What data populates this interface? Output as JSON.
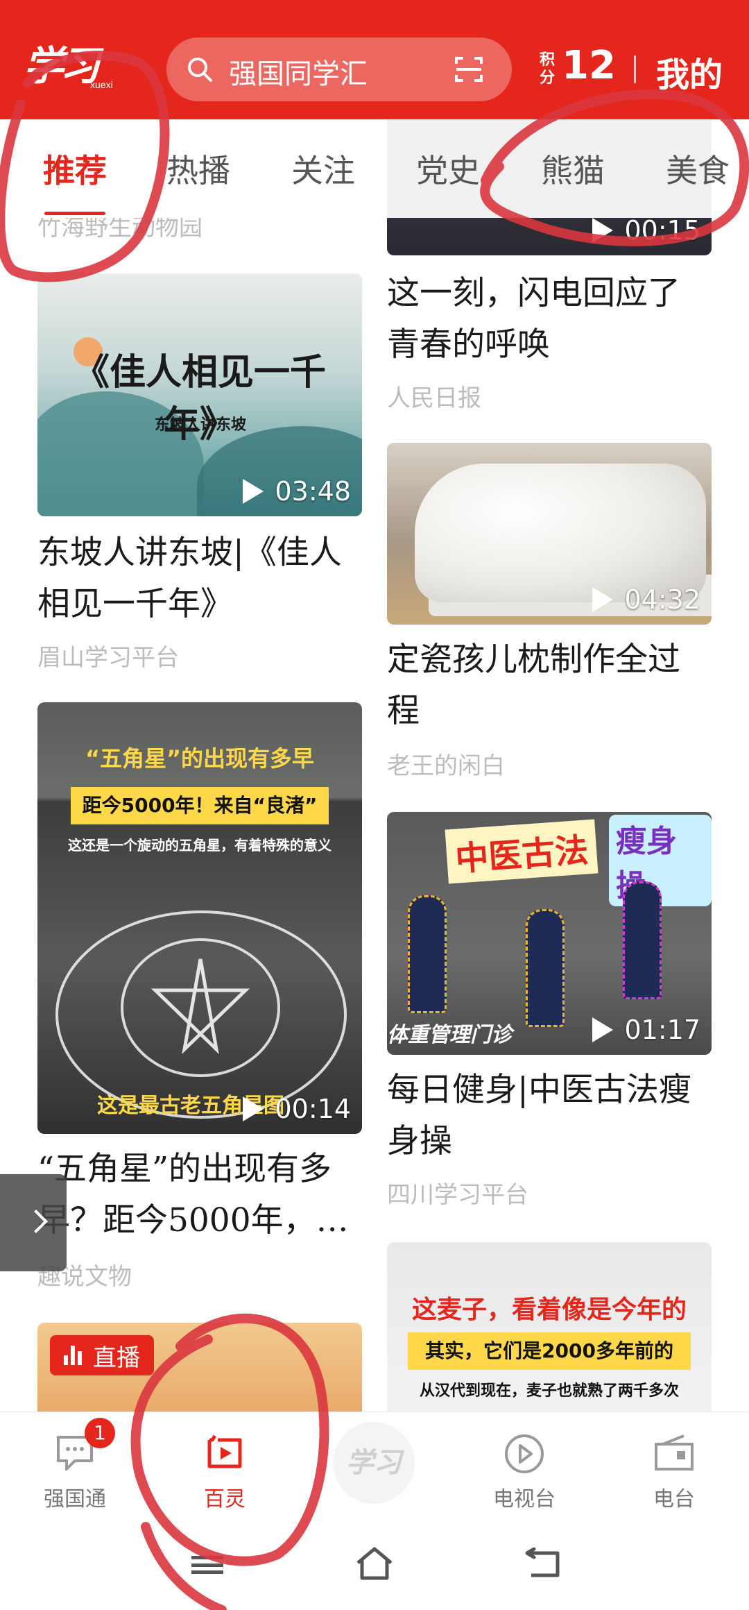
{
  "header": {
    "logo_main": "学习",
    "logo_sub": "xuexi",
    "search_placeholder": "强国同学汇",
    "points_label": "积分",
    "points_value": "12",
    "mine_label": "我的"
  },
  "tabs": [
    {
      "label": "推荐",
      "active": true
    },
    {
      "label": "热播",
      "active": false
    },
    {
      "label": "关注",
      "active": false
    },
    {
      "label": "党史",
      "active": false
    },
    {
      "label": "熊猫",
      "active": false
    },
    {
      "label": "美食",
      "active": false
    }
  ],
  "feed": {
    "left": [
      {
        "source": "竹海野生动物园"
      },
      {
        "title": "东坡人讲东坡|《佳人相见一千年》",
        "source": "眉山学习平台",
        "duration": "03:48",
        "poster_title": "《佳人相见一千年》",
        "poster_sub": "东坡人讲东坡"
      },
      {
        "title": "“五角星”的出现有多早？距今5000年，…",
        "source": "趣说文物",
        "duration": "00:14",
        "headline1": "“五角星”的出现有多早",
        "headline2": "距今5000年！来自“良渚”",
        "headline3": "这还是一个旋动的五角星，有着特殊的意义",
        "caption": "这是最古老五角星图"
      },
      {
        "live_badge": "直播"
      }
    ],
    "right": [
      {
        "duration": "00:15"
      },
      {
        "title": "这一刻，闪电回应了青春的呼唤",
        "source": "人民日报"
      },
      {
        "title": "定瓷孩儿枕制作全过程",
        "source": "老王的闲白",
        "duration": "04:32"
      },
      {
        "title": "每日健身|中医古法瘦身操",
        "source": "四川学习平台",
        "duration": "01:17",
        "tag1": "中医古法",
        "tag2": "瘦身操",
        "caption": "体重管理门诊"
      },
      {
        "headline1": "这麦子，看着像是今年的",
        "headline2": "其实，它们是2000多年前的",
        "headline3": "从汉代到现在，麦子也就熟了两千多次"
      }
    ]
  },
  "bottom_nav": [
    {
      "label": "强国通",
      "icon": "chat-icon",
      "badge": "1",
      "active": false
    },
    {
      "label": "百灵",
      "icon": "video-icon",
      "active": true
    },
    {
      "label": "学习",
      "icon": "xuexi-logo-icon",
      "active": false
    },
    {
      "label": "电视台",
      "icon": "play-circle-icon",
      "active": false
    },
    {
      "label": "电台",
      "icon": "radio-icon",
      "active": false
    }
  ],
  "colors": {
    "brand_red": "#e5261d",
    "annotation_red": "#d9363e"
  }
}
